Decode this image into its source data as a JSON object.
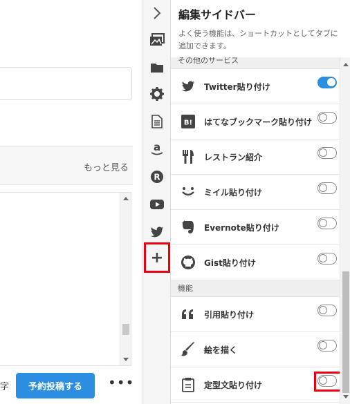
{
  "editor": {
    "more_link": "もっと見る",
    "char_unit": "字",
    "schedule_button": "予約投稿する",
    "more_options": "•••"
  },
  "rail": {
    "toggle_icon": "chevron-right-icon",
    "icons": [
      "image-icon",
      "folder-icon",
      "gear-icon",
      "document-icon",
      "amazon-icon",
      "rakuten-icon",
      "youtube-icon",
      "twitter-icon"
    ],
    "add_label": "+"
  },
  "panel": {
    "title": "編集サイドバー",
    "description": "よく使う機能は、ショートカットとしてタブに追加できます。",
    "section_partial": "その他のサービス",
    "services": [
      {
        "icon": "twitter-icon",
        "label": "Twitter貼り付け",
        "enabled": true
      },
      {
        "icon": "hatena-bookmark-icon",
        "label": "はてなブックマーク貼り付け",
        "enabled": false
      },
      {
        "icon": "restaurant-icon",
        "label": "レストラン紹介",
        "enabled": false
      },
      {
        "icon": "miil-icon",
        "label": "ミイル貼り付け",
        "enabled": false
      },
      {
        "icon": "evernote-icon",
        "label": "Evernote貼り付け",
        "enabled": false
      },
      {
        "icon": "github-icon",
        "label": "Gist貼り付け",
        "enabled": false
      }
    ],
    "section_features": "機能",
    "features": [
      {
        "icon": "quote-icon",
        "label": "引用貼り付け",
        "enabled": false
      },
      {
        "icon": "brush-icon",
        "label": "絵を描く",
        "enabled": false
      },
      {
        "icon": "clipboard-icon",
        "label": "定型文貼り付け",
        "enabled": false
      }
    ]
  },
  "colors": {
    "accent": "#2b8ee0",
    "highlight": "#e60012"
  }
}
